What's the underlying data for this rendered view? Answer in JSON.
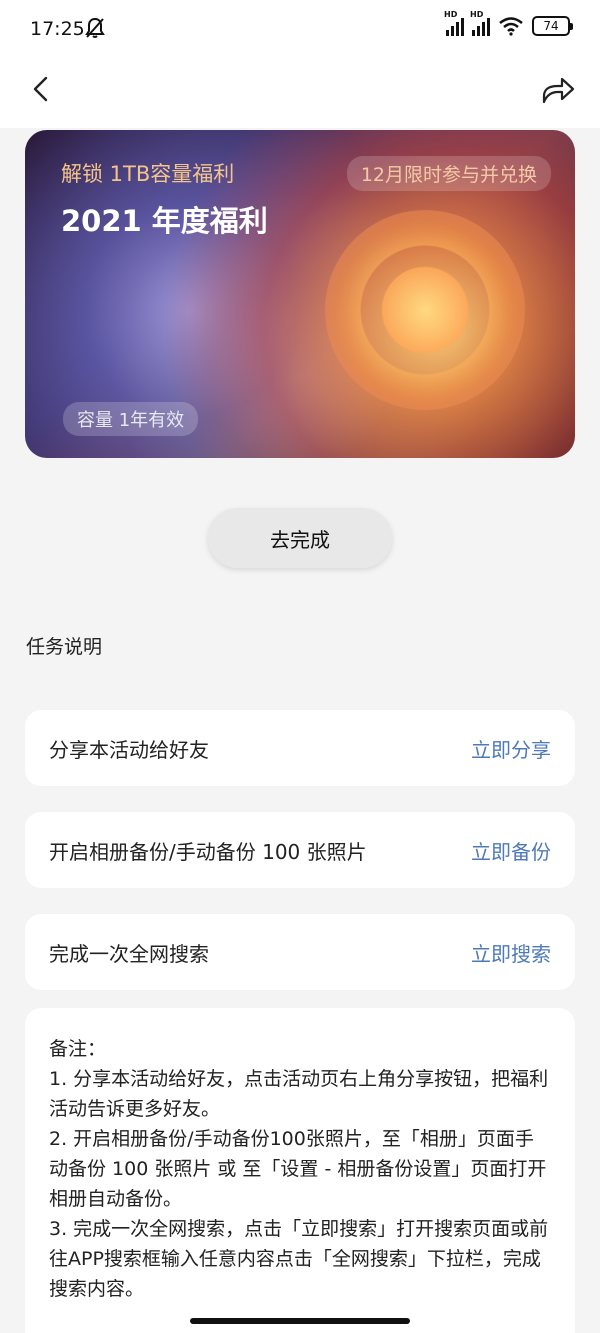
{
  "status_bar": {
    "time": "17:25",
    "battery": "74",
    "signal_label": "HD"
  },
  "hero": {
    "subtitle": "解锁 1TB容量福利",
    "title": "2021 年度福利",
    "badge": "12月限时参与并兑换",
    "validity": "容量 1年有效"
  },
  "cta": {
    "label": "去完成"
  },
  "section": {
    "title": "任务说明"
  },
  "tasks": [
    {
      "label": "分享本活动给好友",
      "action": "立即分享"
    },
    {
      "label": "开启相册备份/手动备份 100 张照片",
      "action": "立即备份"
    },
    {
      "label": "完成一次全网搜索",
      "action": "立即搜索"
    }
  ],
  "notes": {
    "lines": [
      "备注：",
      "1. 分享本活动给好友，点击活动页右上角分享按钮，把福利活动告诉更多好友。",
      "2. 开启相册备份/手动备份100张照片，至「相册」页面手动备份 100 张照片 或 至「设置 - 相册备份设置」页面打开相册自动备份。",
      "3. 完成一次全网搜索，点击「立即搜索」打开搜索页面或前往APP搜索框输入任意内容点击「全网搜索」下拉栏，完成搜索内容。"
    ]
  },
  "colors": {
    "accent_link": "#4e7ab8",
    "hero_subtitle": "#f6c48a",
    "page_bg": "#f4f4f4"
  }
}
